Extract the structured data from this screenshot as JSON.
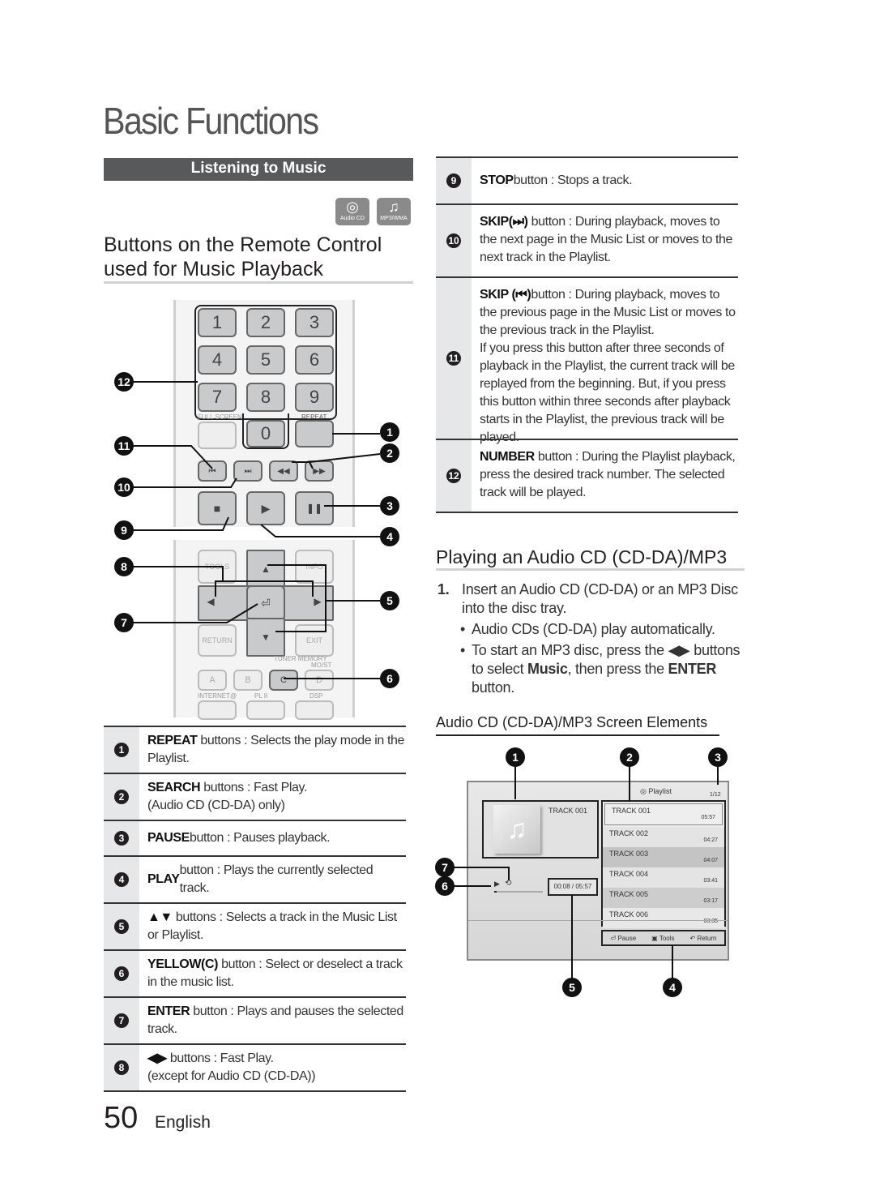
{
  "page": {
    "title": "Basic Functions",
    "section": "Listening to Music",
    "page_number": "50",
    "language": "English"
  },
  "badges": [
    {
      "icon": "disc-icon",
      "label": "Audio CD"
    },
    {
      "icon": "music-note-icon",
      "label": "MP3/WMA"
    }
  ],
  "remote_section": {
    "heading_line1": "Buttons on the Remote Control",
    "heading_line2": "used for Music Playback"
  },
  "remote": {
    "digits": [
      "1",
      "2",
      "3",
      "4",
      "5",
      "6",
      "7",
      "8",
      "9",
      "0"
    ],
    "labels": {
      "full_screen": "FULL SCREEN",
      "repeat": "REPEAT",
      "tools": "TOOLS",
      "info": "INFO",
      "return": "RETURN",
      "exit": "EXIT",
      "tuner_memory": "TUNER MEMORY",
      "mo_st": "MO/ST",
      "internet": "INTERNET@",
      "pl2": "PL II",
      "dsp": "DSP",
      "a": "A",
      "b": "B",
      "c": "C",
      "d": "D"
    },
    "transport_glyphs": {
      "skip_prev": "⏮",
      "skip_next": "⏭",
      "rew": "◀◀",
      "ff": "▶▶",
      "stop": "■",
      "play": "▶",
      "pause": "❚❚"
    },
    "callouts": [
      "1",
      "2",
      "3",
      "4",
      "5",
      "6",
      "7",
      "8",
      "9",
      "10",
      "11",
      "12"
    ]
  },
  "button_table_left": [
    {
      "n": "1",
      "bold": "REPEAT",
      "text": " buttons : Selects the play mode in the Playlist."
    },
    {
      "n": "2",
      "bold": "SEARCH",
      "text": " buttons : Fast Play.",
      "line2": "(Audio CD (CD-DA) only)"
    },
    {
      "n": "3",
      "bold": "PAUSE",
      "text": " button : Pauses playback."
    },
    {
      "n": "4",
      "bold": "PLAY",
      "text": " button : Plays the currently selected track."
    },
    {
      "n": "5",
      "bold": "▲▼",
      "text": " buttons : Selects a track in the Music List or Playlist."
    },
    {
      "n": "6",
      "bold": "YELLOW(C)",
      "text": " button : Select or deselect a track in the music list."
    },
    {
      "n": "7",
      "bold": "ENTER",
      "text": " button : Plays and pauses the selected track."
    },
    {
      "n": "8",
      "bold": "◀▶",
      "text": " buttons : Fast Play.",
      "line2": "(except for Audio CD (CD-DA))"
    }
  ],
  "button_table_right": [
    {
      "n": "9",
      "bold": "STOP",
      "text": " button : Stops a track."
    },
    {
      "n": "10",
      "bold": "SKIP(⏭)",
      "text": " button : During playback, moves to the next page in the Music List or moves to the next track in the Playlist."
    },
    {
      "n": "11",
      "bold": "SKIP (⏮)",
      "text": "button : During playback, moves to the previous page in the Music List or moves to the previous track in the Playlist.",
      "line2": "If you press this button after three seconds of playback in the Playlist, the current track will be replayed from the beginning. But, if you press this button within three seconds after playback starts in the Playlist, the previous track will be played."
    },
    {
      "n": "12",
      "bold": "NUMBER",
      "text": " button : During the Playlist playback, press the desired track number. The selected track will be played."
    }
  ],
  "playing": {
    "heading": "Playing an Audio CD (CD-DA)/MP3",
    "step_num": "1.",
    "step_text": "Insert an Audio CD (CD-DA) or an MP3 Disc into the disc tray.",
    "bullet1": "Audio CDs (CD-DA) play automatically.",
    "bullet2_a": "To start an MP3 disc, press the ◀▶ buttons to select ",
    "bullet2_bold1": "Music",
    "bullet2_b": ", then press the ",
    "bullet2_bold2": "ENTER",
    "bullet2_c": " button."
  },
  "screen_elements": {
    "heading": "Audio CD (CD-DA)/MP3 Screen Elements",
    "current_track": "TRACK 001",
    "time": "00:08 / 05:57",
    "progress_fraction": 0.02,
    "playlist_label": "Playlist",
    "page_count": "1/12",
    "tracks": [
      {
        "name": "TRACK 001",
        "duration": "05:57"
      },
      {
        "name": "TRACK 002",
        "duration": "04:27"
      },
      {
        "name": "TRACK 003",
        "duration": "04:07"
      },
      {
        "name": "TRACK 004",
        "duration": "03:41"
      },
      {
        "name": "TRACK 005",
        "duration": "03:17"
      },
      {
        "name": "TRACK 006",
        "duration": "03:35"
      }
    ],
    "footer": {
      "pause": "Pause",
      "tools": "Tools",
      "return": "Return"
    },
    "callouts": [
      "1",
      "2",
      "3",
      "4",
      "5",
      "6",
      "7"
    ]
  }
}
